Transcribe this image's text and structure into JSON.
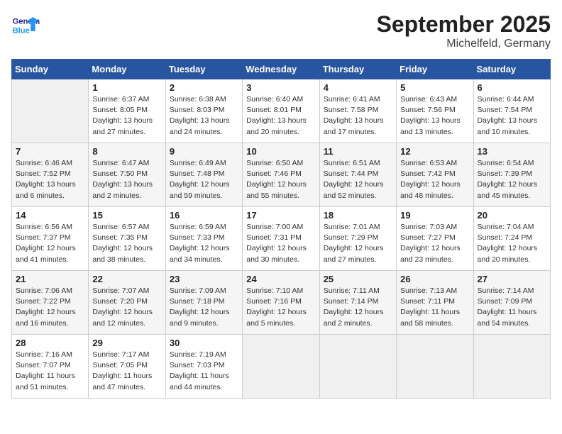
{
  "header": {
    "logo_general": "General",
    "logo_blue": "Blue",
    "month_title": "September 2025",
    "location": "Michelfeld, Germany"
  },
  "weekdays": [
    "Sunday",
    "Monday",
    "Tuesday",
    "Wednesday",
    "Thursday",
    "Friday",
    "Saturday"
  ],
  "weeks": [
    [
      {
        "day": "",
        "info": ""
      },
      {
        "day": "1",
        "info": "Sunrise: 6:37 AM\nSunset: 8:05 PM\nDaylight: 13 hours\nand 27 minutes."
      },
      {
        "day": "2",
        "info": "Sunrise: 6:38 AM\nSunset: 8:03 PM\nDaylight: 13 hours\nand 24 minutes."
      },
      {
        "day": "3",
        "info": "Sunrise: 6:40 AM\nSunset: 8:01 PM\nDaylight: 13 hours\nand 20 minutes."
      },
      {
        "day": "4",
        "info": "Sunrise: 6:41 AM\nSunset: 7:58 PM\nDaylight: 13 hours\nand 17 minutes."
      },
      {
        "day": "5",
        "info": "Sunrise: 6:43 AM\nSunset: 7:56 PM\nDaylight: 13 hours\nand 13 minutes."
      },
      {
        "day": "6",
        "info": "Sunrise: 6:44 AM\nSunset: 7:54 PM\nDaylight: 13 hours\nand 10 minutes."
      }
    ],
    [
      {
        "day": "7",
        "info": "Sunrise: 6:46 AM\nSunset: 7:52 PM\nDaylight: 13 hours\nand 6 minutes."
      },
      {
        "day": "8",
        "info": "Sunrise: 6:47 AM\nSunset: 7:50 PM\nDaylight: 13 hours\nand 2 minutes."
      },
      {
        "day": "9",
        "info": "Sunrise: 6:49 AM\nSunset: 7:48 PM\nDaylight: 12 hours\nand 59 minutes."
      },
      {
        "day": "10",
        "info": "Sunrise: 6:50 AM\nSunset: 7:46 PM\nDaylight: 12 hours\nand 55 minutes."
      },
      {
        "day": "11",
        "info": "Sunrise: 6:51 AM\nSunset: 7:44 PM\nDaylight: 12 hours\nand 52 minutes."
      },
      {
        "day": "12",
        "info": "Sunrise: 6:53 AM\nSunset: 7:42 PM\nDaylight: 12 hours\nand 48 minutes."
      },
      {
        "day": "13",
        "info": "Sunrise: 6:54 AM\nSunset: 7:39 PM\nDaylight: 12 hours\nand 45 minutes."
      }
    ],
    [
      {
        "day": "14",
        "info": "Sunrise: 6:56 AM\nSunset: 7:37 PM\nDaylight: 12 hours\nand 41 minutes."
      },
      {
        "day": "15",
        "info": "Sunrise: 6:57 AM\nSunset: 7:35 PM\nDaylight: 12 hours\nand 38 minutes."
      },
      {
        "day": "16",
        "info": "Sunrise: 6:59 AM\nSunset: 7:33 PM\nDaylight: 12 hours\nand 34 minutes."
      },
      {
        "day": "17",
        "info": "Sunrise: 7:00 AM\nSunset: 7:31 PM\nDaylight: 12 hours\nand 30 minutes."
      },
      {
        "day": "18",
        "info": "Sunrise: 7:01 AM\nSunset: 7:29 PM\nDaylight: 12 hours\nand 27 minutes."
      },
      {
        "day": "19",
        "info": "Sunrise: 7:03 AM\nSunset: 7:27 PM\nDaylight: 12 hours\nand 23 minutes."
      },
      {
        "day": "20",
        "info": "Sunrise: 7:04 AM\nSunset: 7:24 PM\nDaylight: 12 hours\nand 20 minutes."
      }
    ],
    [
      {
        "day": "21",
        "info": "Sunrise: 7:06 AM\nSunset: 7:22 PM\nDaylight: 12 hours\nand 16 minutes."
      },
      {
        "day": "22",
        "info": "Sunrise: 7:07 AM\nSunset: 7:20 PM\nDaylight: 12 hours\nand 12 minutes."
      },
      {
        "day": "23",
        "info": "Sunrise: 7:09 AM\nSunset: 7:18 PM\nDaylight: 12 hours\nand 9 minutes."
      },
      {
        "day": "24",
        "info": "Sunrise: 7:10 AM\nSunset: 7:16 PM\nDaylight: 12 hours\nand 5 minutes."
      },
      {
        "day": "25",
        "info": "Sunrise: 7:11 AM\nSunset: 7:14 PM\nDaylight: 12 hours\nand 2 minutes."
      },
      {
        "day": "26",
        "info": "Sunrise: 7:13 AM\nSunset: 7:11 PM\nDaylight: 11 hours\nand 58 minutes."
      },
      {
        "day": "27",
        "info": "Sunrise: 7:14 AM\nSunset: 7:09 PM\nDaylight: 11 hours\nand 54 minutes."
      }
    ],
    [
      {
        "day": "28",
        "info": "Sunrise: 7:16 AM\nSunset: 7:07 PM\nDaylight: 11 hours\nand 51 minutes."
      },
      {
        "day": "29",
        "info": "Sunrise: 7:17 AM\nSunset: 7:05 PM\nDaylight: 11 hours\nand 47 minutes."
      },
      {
        "day": "30",
        "info": "Sunrise: 7:19 AM\nSunset: 7:03 PM\nDaylight: 11 hours\nand 44 minutes."
      },
      {
        "day": "",
        "info": ""
      },
      {
        "day": "",
        "info": ""
      },
      {
        "day": "",
        "info": ""
      },
      {
        "day": "",
        "info": ""
      }
    ]
  ]
}
